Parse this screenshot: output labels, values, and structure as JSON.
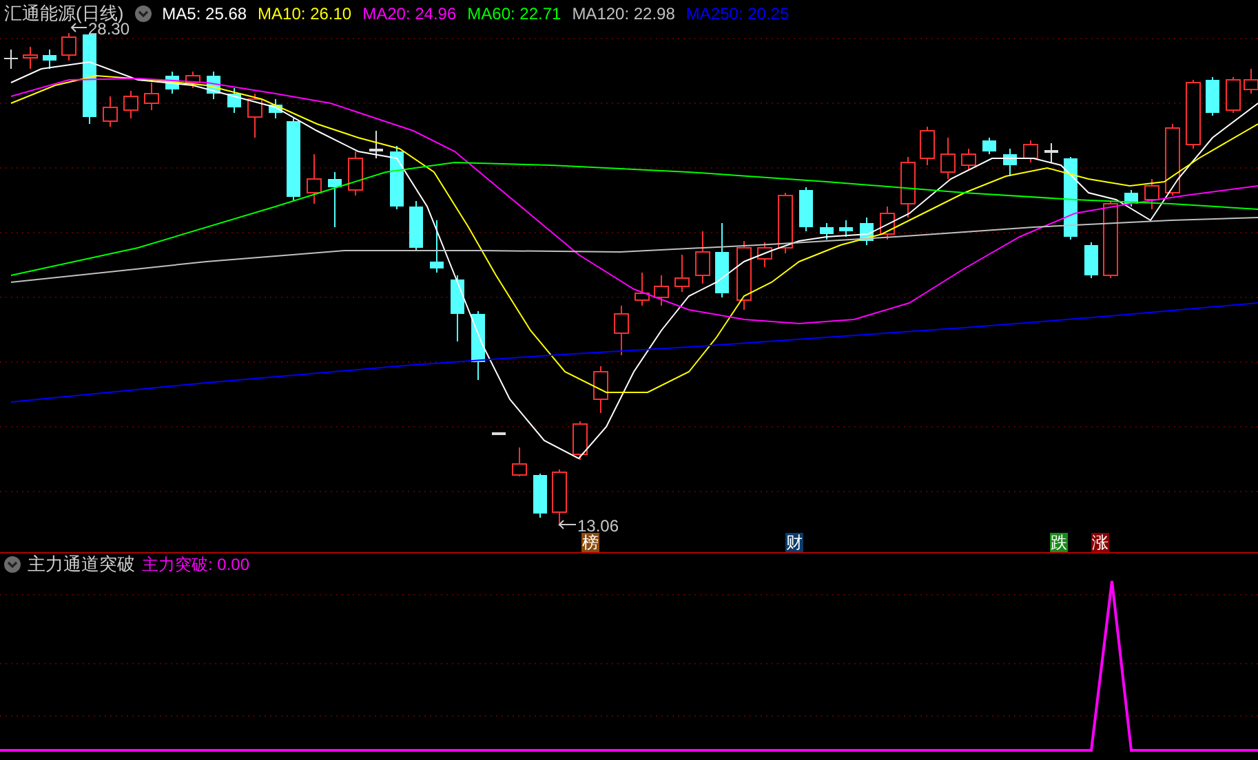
{
  "main_panel": {
    "title": "汇通能源(日线)",
    "ma_legend": [
      {
        "label": "MA5: 25.68",
        "color": "#ffffff"
      },
      {
        "label": "MA10: 26.10",
        "color": "#ffff00"
      },
      {
        "label": "MA20: 24.96",
        "color": "#ff00ff"
      },
      {
        "label": "MA60: 22.71",
        "color": "#00ff00"
      },
      {
        "label": "MA120: 22.98",
        "color": "#c0c0c0"
      },
      {
        "label": "MA250: 20.25",
        "color": "#0000ff"
      }
    ],
    "high_label": "28.30",
    "low_label": "13.06",
    "events": [
      {
        "label": "榜",
        "color": "#8b4a0c"
      },
      {
        "label": "财",
        "color": "#0b3b6b"
      },
      {
        "label": "跌",
        "color": "#1a8a1a"
      },
      {
        "label": "涨",
        "color": "#8b0000"
      }
    ]
  },
  "indicator_panel": {
    "title": "主力通道突破",
    "legend": "主力突破: 0.00"
  }
}
